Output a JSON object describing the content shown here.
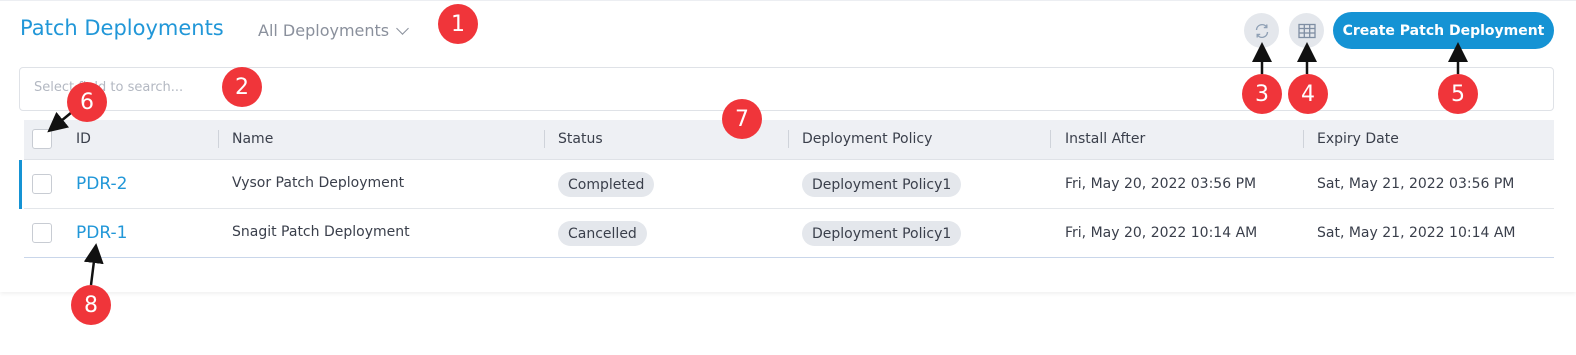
{
  "header": {
    "title": "Patch Deployments",
    "view_selector": "All Deployments",
    "refresh_icon": "refresh-icon",
    "grid_icon": "table-grid-icon",
    "create_label": "Create Patch Deployment"
  },
  "search": {
    "placeholder": "Select field to search..."
  },
  "table": {
    "columns": [
      "ID",
      "Name",
      "Status",
      "Deployment Policy",
      "Install After",
      "Expiry Date"
    ],
    "rows": [
      {
        "id": "PDR-2",
        "name": "Vysor Patch Deployment",
        "status": "Completed",
        "policy": "Deployment Policy1",
        "install_after": "Fri, May 20, 2022 03:56 PM",
        "expiry": "Sat, May 21, 2022 03:56 PM"
      },
      {
        "id": "PDR-1",
        "name": "Snagit Patch Deployment",
        "status": "Cancelled",
        "policy": "Deployment Policy1",
        "install_after": "Fri, May 20, 2022 10:14 AM",
        "expiry": "Sat, May 21, 2022 10:14 AM"
      }
    ]
  },
  "callouts": [
    "1",
    "2",
    "3",
    "4",
    "5",
    "6",
    "7",
    "8"
  ],
  "colors": {
    "accent": "#1593d4",
    "title": "#2197d8",
    "callout": "#f0353a"
  }
}
